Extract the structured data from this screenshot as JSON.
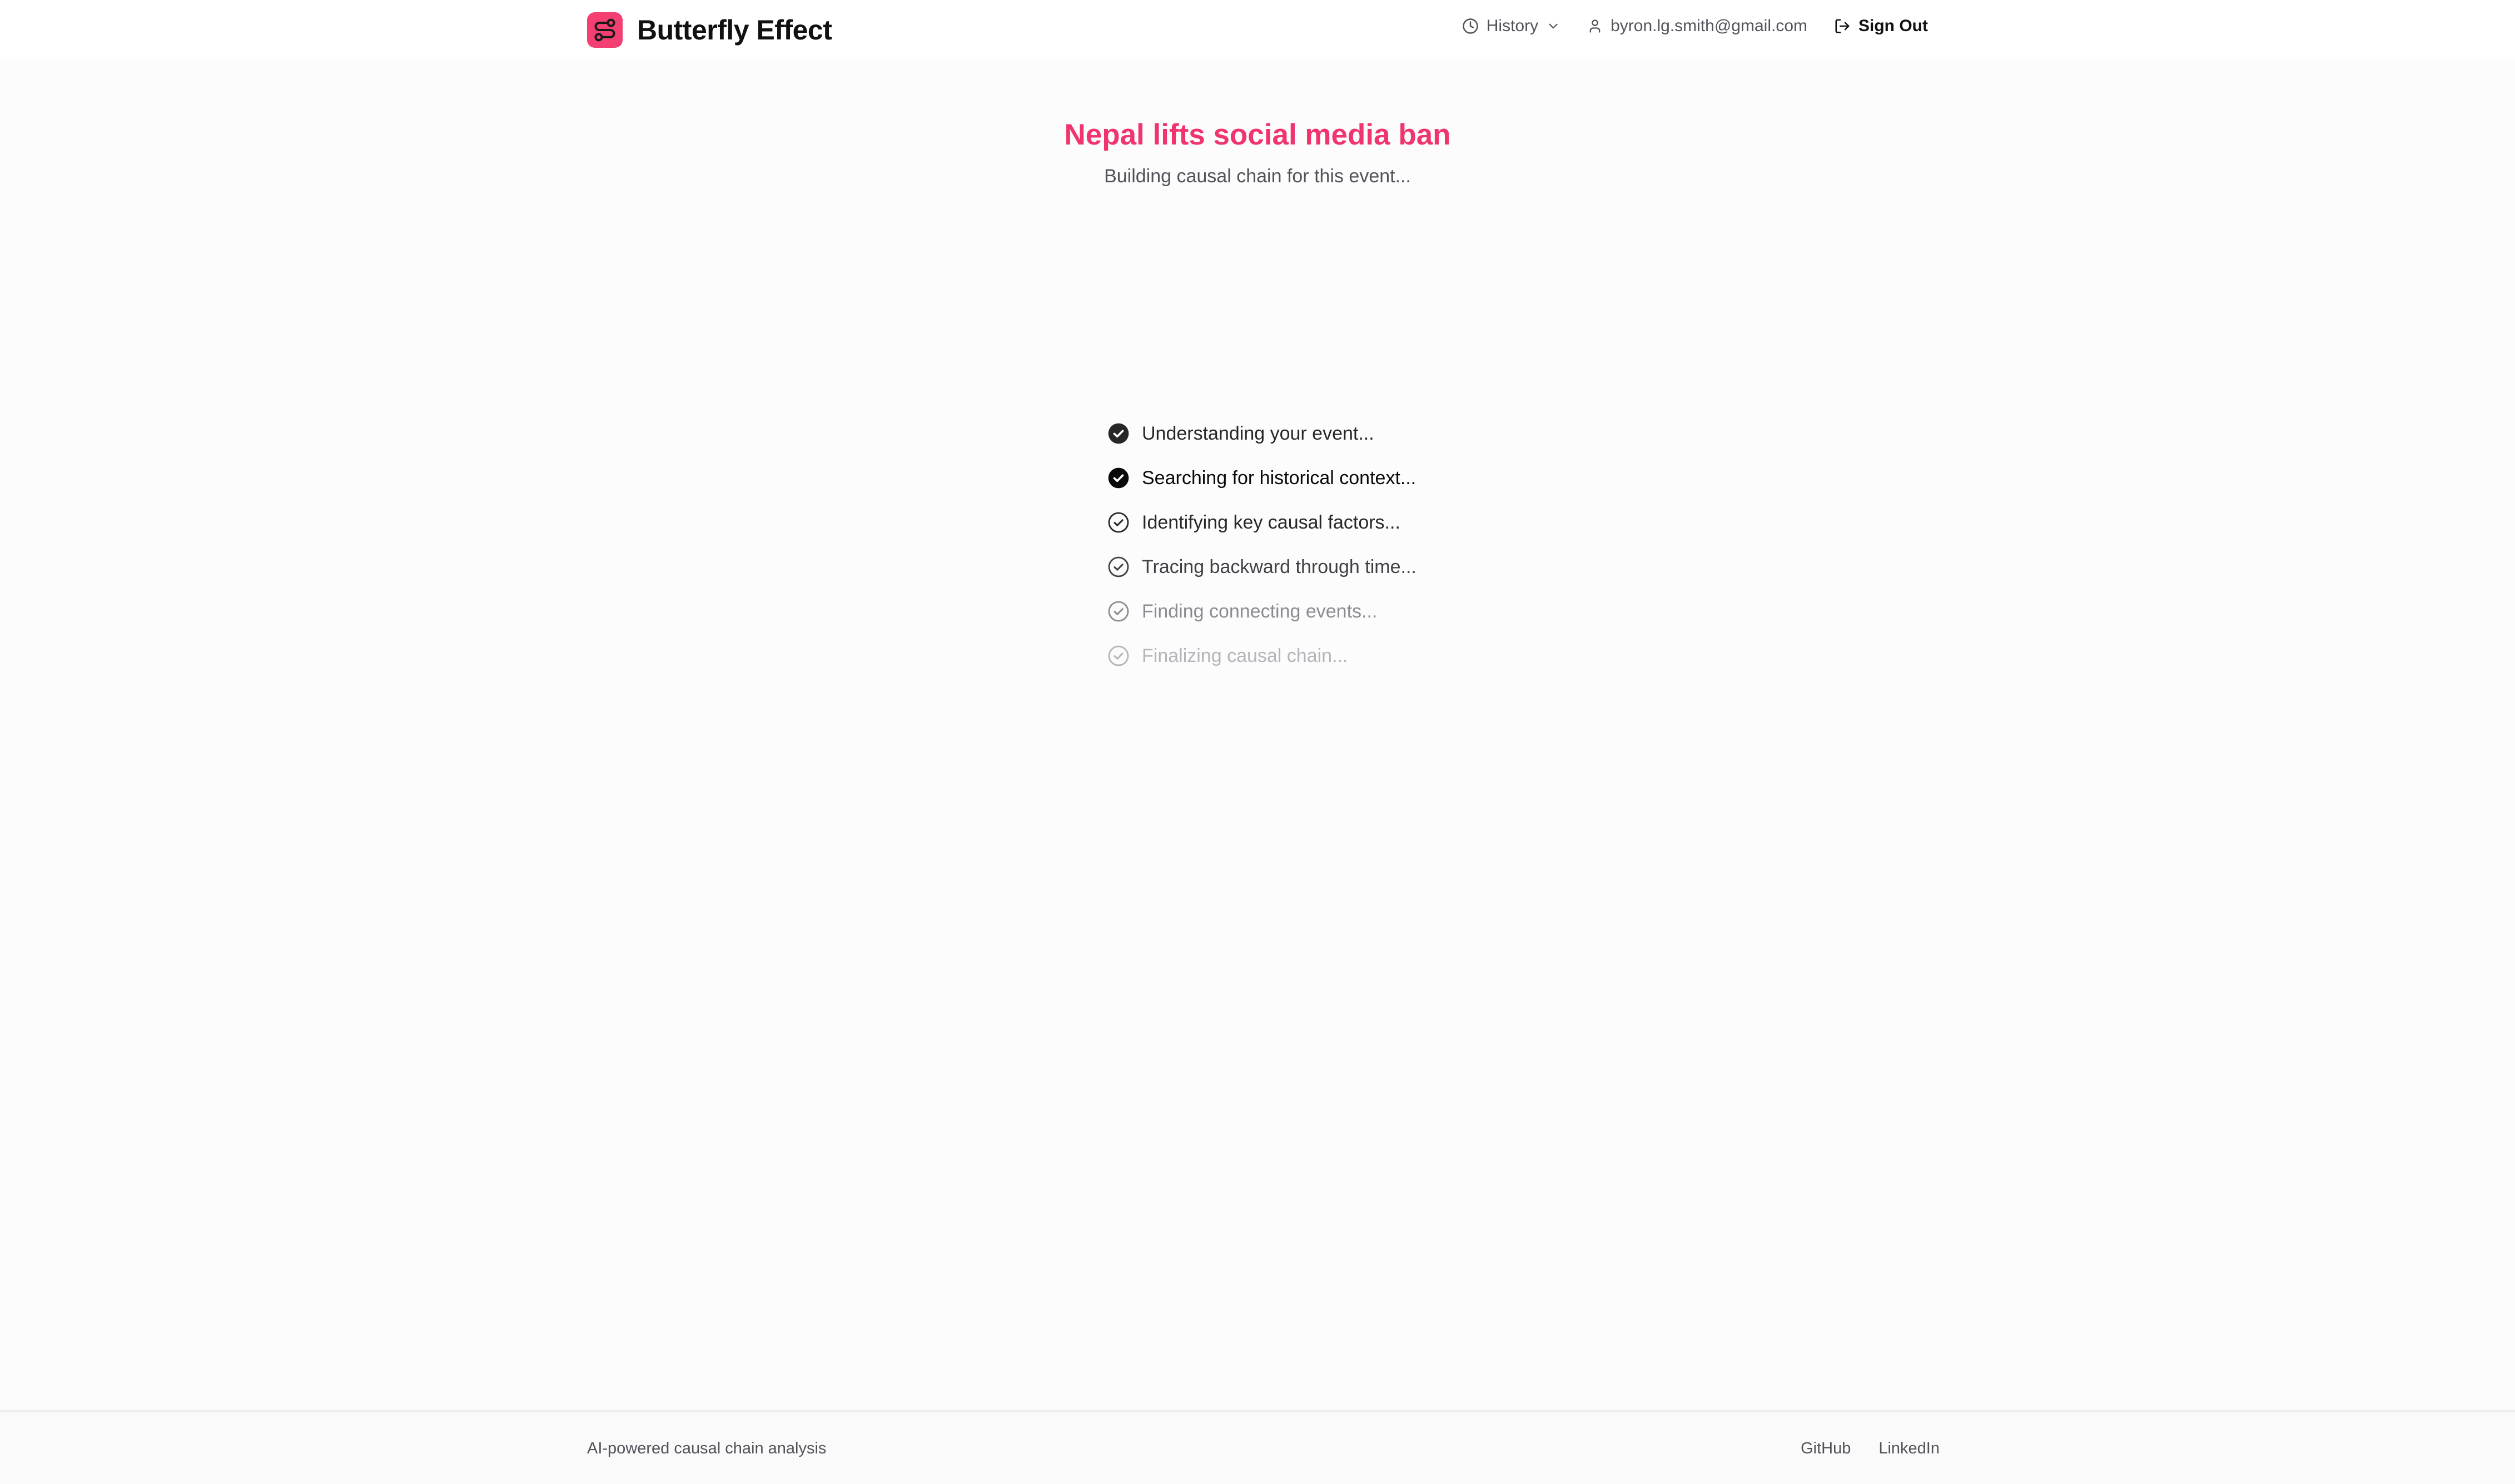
{
  "header": {
    "brand": "Butterfly Effect",
    "history_label": "History",
    "user_email": "byron.lg.smith@gmail.com",
    "sign_out_label": "Sign Out"
  },
  "main": {
    "event_title": "Nepal lifts social media ban",
    "status_text": "Building causal chain for this event...",
    "steps": [
      {
        "label": "Understanding your event...",
        "state": "done"
      },
      {
        "label": "Searching for historical context...",
        "state": "done"
      },
      {
        "label": "Identifying key causal factors...",
        "state": "pending"
      },
      {
        "label": "Tracing backward through time...",
        "state": "pending"
      },
      {
        "label": "Finding connecting events...",
        "state": "pending"
      },
      {
        "label": "Finalizing causal chain...",
        "state": "pending"
      }
    ]
  },
  "footer": {
    "tagline": "AI-powered causal chain analysis",
    "links": [
      "GitHub",
      "LinkedIn"
    ]
  },
  "colors": {
    "accent": "#f0346d",
    "logo_bg": "#f43f72"
  },
  "icons": {
    "logo": "route-icon",
    "history": "clock-icon",
    "history_toggle": "chevron-down-icon",
    "user": "user-icon",
    "sign_out": "log-out-icon",
    "step_done": "check-circle-filled-icon",
    "step_pending": "check-circle-outline-icon"
  }
}
